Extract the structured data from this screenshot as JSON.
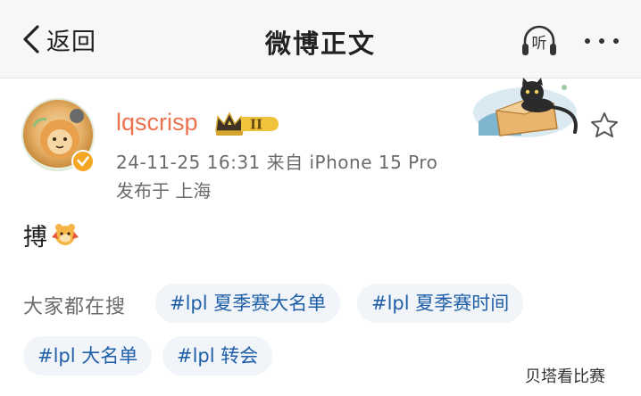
{
  "header": {
    "back_label": "返回",
    "title": "微博正文",
    "listen_label": "听"
  },
  "post": {
    "username": "lqscrisp",
    "vip_level": "II",
    "meta": "24-11-25 16:31 来自 iPhone 15 Pro",
    "location": "发布于 上海",
    "content": "搏"
  },
  "related_searches": {
    "label": "大家都在搜",
    "tags": [
      "#lpl 夏季赛大名单",
      "#lpl 夏季赛时间",
      "#lpl 大名单",
      "#lpl 转会"
    ]
  },
  "watermark": "贝塔看比赛",
  "colors": {
    "username": "#eb7350",
    "verified_badge": "#f5a623",
    "tag_background": "#f1f4f8"
  }
}
